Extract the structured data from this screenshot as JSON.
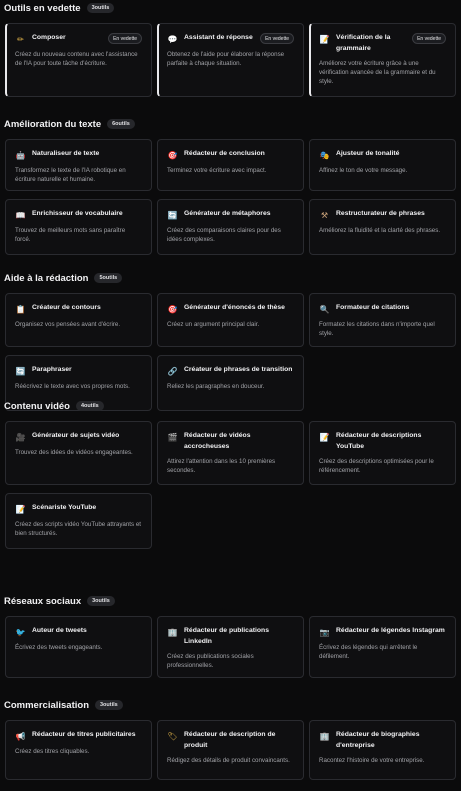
{
  "sections": [
    {
      "title": "Outils en vedette",
      "count": "3outils",
      "cards": [
        {
          "icon": "pencil-icon",
          "glyph": "✏",
          "color": "#f2c14e",
          "title": "Composer",
          "tag": "En vedette",
          "desc": "Créez du nouveau contenu avec l'assistance de l'IA pour toute tâche d'écriture."
        },
        {
          "icon": "chat-icon",
          "glyph": "💬",
          "color": "#cfd3da",
          "title": "Assistant de réponse",
          "tag": "En vedette",
          "desc": "Obtenez de l'aide pour élaborer la réponse parfaite à chaque situation."
        },
        {
          "icon": "memo-icon",
          "glyph": "📝",
          "color": "#f4e6b0",
          "title": "Vérification de la grammaire",
          "tag": "En vedette",
          "desc": "Améliorez votre écriture grâce à une vérification avancée de la grammaire et du style."
        }
      ]
    },
    {
      "title": "Amélioration du texte",
      "count": "6outils",
      "cards": [
        {
          "icon": "robot-icon",
          "glyph": "🤖",
          "color": "#b8c0cc",
          "title": "Naturaliseur de texte",
          "desc": "Transformez le texte de l'IA robotique en écriture naturelle et humaine."
        },
        {
          "icon": "target-icon",
          "glyph": "🎯",
          "color": "#e5484d",
          "title": "Rédacteur de conclusion",
          "desc": "Terminez votre écriture avec impact."
        },
        {
          "icon": "theater-masks-icon",
          "glyph": "🎭",
          "color": "#f2c14e",
          "title": "Ajusteur de tonalité",
          "desc": "Affinez le ton de votre message."
        },
        {
          "icon": "book-icon",
          "glyph": "📖",
          "color": "#dfe3ea",
          "title": "Enrichisseur de vocabulaire",
          "desc": "Trouvez de meilleurs mots sans paraître forcé."
        },
        {
          "icon": "cycle-icon",
          "glyph": "🔄",
          "color": "#3b82f6",
          "title": "Générateur de métaphores",
          "desc": "Créez des comparaisons claires pour des idées complexes."
        },
        {
          "icon": "tools-icon",
          "glyph": "⚒",
          "color": "#c9a27a",
          "title": "Restructurateur de phrases",
          "desc": "Améliorez la fluidité et la clarté des phrases."
        }
      ]
    },
    {
      "title": "Aide à la rédaction",
      "count": "5outils",
      "cards": [
        {
          "icon": "clipboard-icon",
          "glyph": "📋",
          "color": "#e6c79a",
          "title": "Créateur de contours",
          "desc": "Organisez vos pensées avant d'écrire."
        },
        {
          "icon": "target-icon",
          "glyph": "🎯",
          "color": "#e5484d",
          "title": "Générateur d'énoncés de thèse",
          "desc": "Créez un argument principal clair."
        },
        {
          "icon": "magnifier-icon",
          "glyph": "🔍",
          "color": "#8fb3e8",
          "title": "Formateur de citations",
          "desc": "Formatez les citations dans n'importe quel style."
        },
        {
          "icon": "cycle-icon",
          "glyph": "🔄",
          "color": "#3b82f6",
          "title": "Paraphraser",
          "desc": "Réécrivez le texte avec vos propres mots."
        },
        {
          "icon": "link-icon",
          "glyph": "🔗",
          "color": "#cfd3da",
          "title": "Créateur de phrases de transition",
          "desc": "Reliez les paragraphes en douceur."
        }
      ]
    },
    {
      "title": "Contenu vidéo",
      "count": "4outils",
      "cards": [
        {
          "icon": "video-camera-icon",
          "glyph": "🎥",
          "color": "#9aa0aa",
          "title": "Générateur de sujets vidéo",
          "desc": "Trouvez des idées de vidéos engageantes."
        },
        {
          "icon": "clapper-board-icon",
          "glyph": "🎬",
          "color": "#cfd3da",
          "title": "Rédacteur de vidéos accrocheuses",
          "desc": "Attirez l'attention dans les 10 premières secondes."
        },
        {
          "icon": "memo-icon",
          "glyph": "📝",
          "color": "#f4e6b0",
          "title": "Rédacteur de descriptions YouTube",
          "desc": "Créez des descriptions optimisées pour le référencement."
        },
        {
          "icon": "memo-icon",
          "glyph": "📝",
          "color": "#f4e6b0",
          "title": "Scénariste YouTube",
          "desc": "Créez des scripts vidéo YouTube attrayants et bien structurés."
        }
      ]
    },
    {
      "title": "Réseaux sociaux",
      "count": "3outils",
      "cards": [
        {
          "icon": "bird-icon",
          "glyph": "🐦",
          "color": "#e5484d",
          "title": "Auteur de tweets",
          "desc": "Écrivez des tweets engageants."
        },
        {
          "icon": "office-building-icon",
          "glyph": "🏢",
          "color": "#8fb3e8",
          "title": "Rédacteur de publications LinkedIn",
          "desc": "Créez des publications sociales professionnelles."
        },
        {
          "icon": "camera-icon",
          "glyph": "📷",
          "color": "#c9a27a",
          "title": "Rédacteur de légendes Instagram",
          "desc": "Écrivez des légendes qui arrêtent le défilement."
        }
      ]
    },
    {
      "title": "Commercialisation",
      "count": "3outils",
      "cards": [
        {
          "icon": "megaphone-icon",
          "glyph": "📢",
          "color": "#e5484d",
          "title": "Rédacteur de titres publicitaires",
          "desc": "Créez des titres cliquables."
        },
        {
          "icon": "price-tag-icon",
          "glyph": "🏷",
          "color": "#f2c14e",
          "title": "Rédacteur de description de produit",
          "desc": "Rédigez des détails de produit convaincants."
        },
        {
          "icon": "building-icon",
          "glyph": "🏢",
          "color": "#8fb3e8",
          "title": "Rédacteur de biographies d'entreprise",
          "desc": "Racontez l'histoire de votre entreprise."
        }
      ]
    }
  ]
}
